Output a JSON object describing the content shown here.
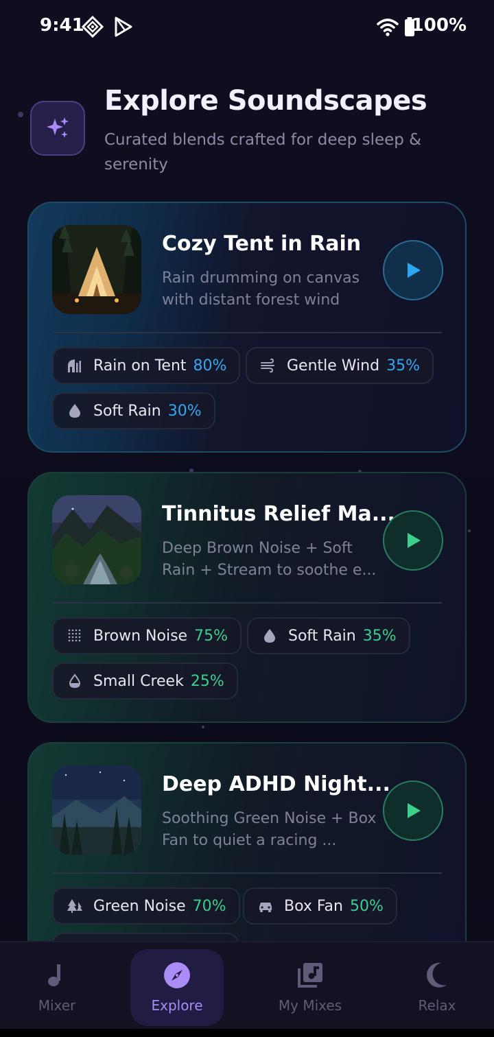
{
  "status": {
    "time": "9:41",
    "battery": "100%"
  },
  "header": {
    "title": "Explore Soundscapes",
    "subtitle": "Curated blends crafted for deep sleep & serenity"
  },
  "cards": [
    {
      "title": "Cozy Tent in Rain",
      "description": "Rain drumming on canvas with distant forest wind",
      "theme": "blue",
      "sounds": [
        {
          "name": "Rain on Tent",
          "level": "80%",
          "icon": "rain-on-tent-icon"
        },
        {
          "name": "Gentle Wind",
          "level": "35%",
          "icon": "wind-icon"
        },
        {
          "name": "Soft Rain",
          "level": "30%",
          "icon": "droplet-icon"
        }
      ]
    },
    {
      "title": "Tinnitus Relief Ma...",
      "description": "Deep Brown Noise + Soft Rain + Stream to soothe e...",
      "theme": "green",
      "sounds": [
        {
          "name": "Brown Noise",
          "level": "75%",
          "icon": "noise-grid-icon"
        },
        {
          "name": "Soft Rain",
          "level": "35%",
          "icon": "droplet-icon"
        },
        {
          "name": "Small Creek",
          "level": "25%",
          "icon": "water-drop-icon"
        }
      ]
    },
    {
      "title": "Deep ADHD Night...",
      "description": "Soothing Green Noise + Box Fan to quiet a racing ...",
      "theme": "green",
      "sounds": [
        {
          "name": "Green Noise",
          "level": "70%",
          "icon": "trees-icon"
        },
        {
          "name": "Box Fan",
          "level": "50%",
          "icon": "car-icon"
        }
      ]
    }
  ],
  "nav": [
    {
      "label": "Mixer",
      "icon": "music-note-icon",
      "active": false
    },
    {
      "label": "Explore",
      "icon": "compass-icon",
      "active": true
    },
    {
      "label": "My Mixes",
      "icon": "library-music-icon",
      "active": false
    },
    {
      "label": "Relax",
      "icon": "moon-icon",
      "active": false
    }
  ],
  "colors": {
    "accent_blue": "#36a8f0",
    "accent_green": "#3ccf8e",
    "accent_purple": "#a98cf6",
    "background": "#0c0c1c"
  }
}
